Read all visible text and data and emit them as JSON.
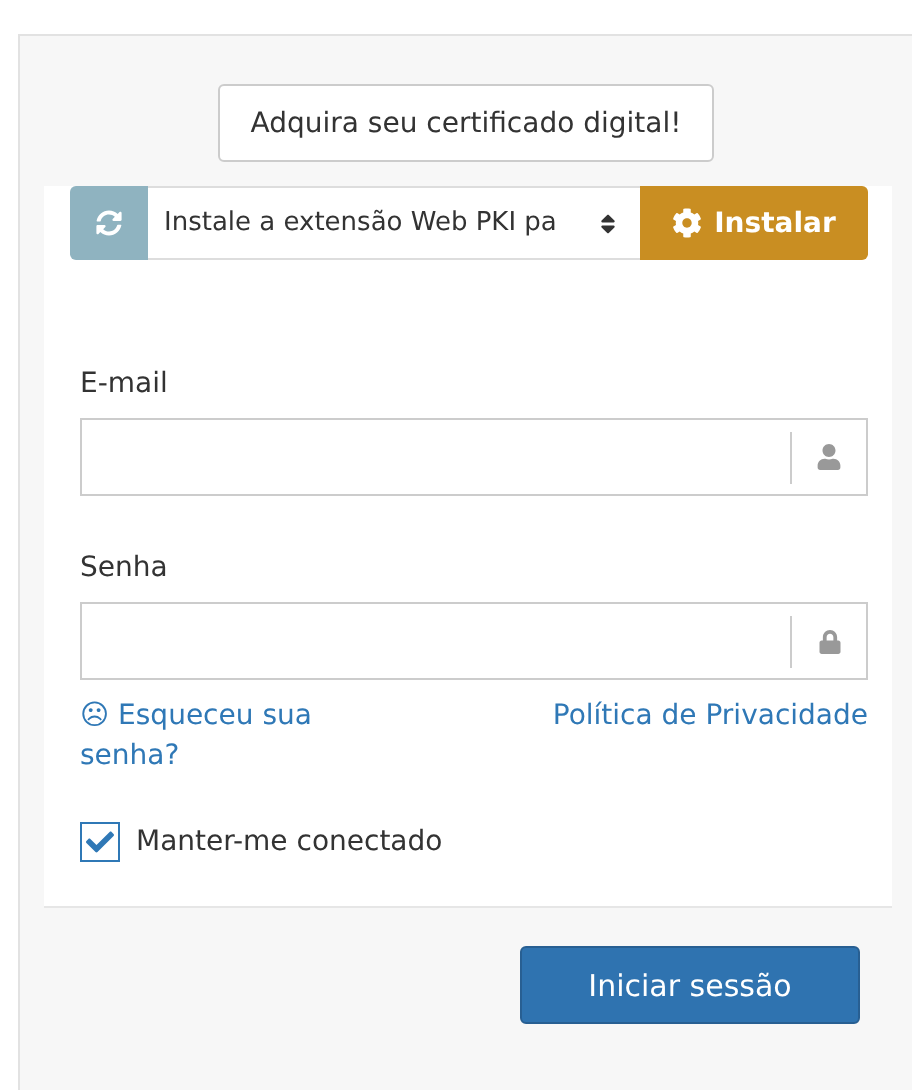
{
  "promo_button": "Adquira seu certificado digital!",
  "certificate_bar": {
    "select_value": "Instale a extensão Web PKI pa",
    "install_button": "Instalar"
  },
  "form": {
    "email_label": "E-mail",
    "password_label": "Senha",
    "forgot_link": "☹ Esqueceu sua senha?",
    "privacy_link": "Política de Privacidade",
    "remember": {
      "label": "Manter-me conectado",
      "checked": true
    }
  },
  "submit_button": "Iniciar sessão"
}
